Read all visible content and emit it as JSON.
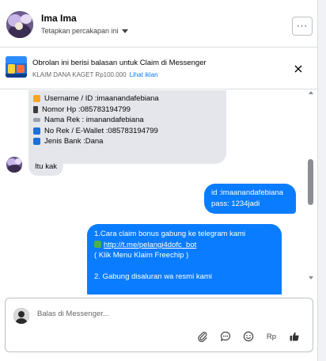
{
  "header": {
    "name": "Ima Ima",
    "pin_label": "Tetapkan percakapan ini",
    "more_label": "···"
  },
  "banner": {
    "title": "Obrolan ini berisi balasan untuk Claim di Messenger",
    "subtitle": "KLAIM DANA KAGET Rp100.000",
    "link": "Lihat iklan"
  },
  "messages": {
    "m1": [
      "Username / ID :imaanandafebiana",
      "Nomor Hp :085783194799",
      "Nama Rek : imanandafebiana",
      "No Rek / E-Wallet :085783194799",
      "Jenis Bank :Dana"
    ],
    "m2": "Itu kak",
    "m3_line1": "id :imaanandafebiana",
    "m3_line2": "pass: 1234jadi",
    "m4_line1": "1.Cara claim bonus gabung ke telegram kami",
    "m4_link": "http://t.me/pelangi4dofc_bot",
    "m4_line3": "( Klik Menu Klaim Freechip )",
    "m4_line4": "2. Gabung disaluran wa resmi kami"
  },
  "composer": {
    "placeholder": "Balas di Messenger...",
    "rp_label": "Rp"
  },
  "colors": {
    "outgoing": "#0a7cff",
    "incoming": "#e4e6eb",
    "link": "#0a7cff"
  },
  "icons": [
    "chevron-down-icon",
    "close-icon",
    "paperclip-icon",
    "chat-bubble-icon",
    "emoji-icon",
    "thumbs-up-icon"
  ]
}
